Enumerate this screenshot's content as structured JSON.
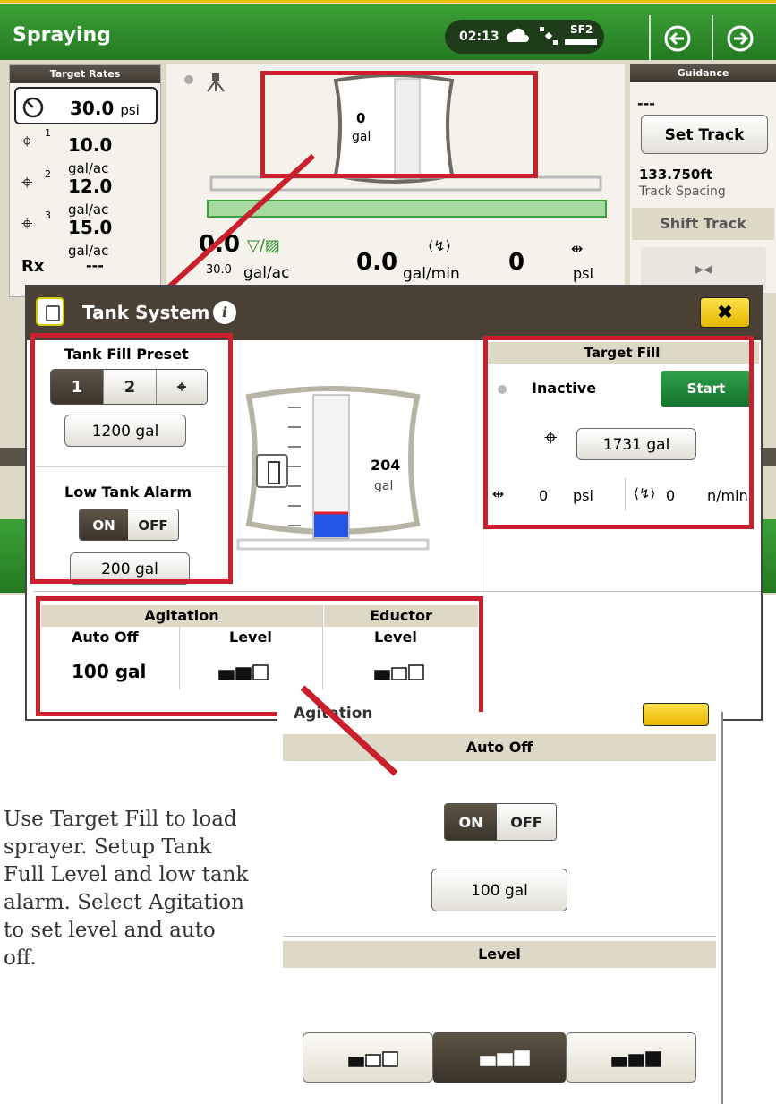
{
  "screen": {
    "title": "Spraying",
    "clock": "02:13",
    "signal_label": "SF2",
    "nav_back_icon": "circle-arrow-left-icon",
    "nav_forward_icon": "circle-arrow-right-icon"
  },
  "target_rates": {
    "header": "Target Rates",
    "rows": [
      {
        "icon": "pressure-gauge-icon",
        "value": "30.0",
        "unit": "psi"
      },
      {
        "icon": "target-1-icon",
        "sup": "1",
        "value": "10.0",
        "unit": "gal/ac"
      },
      {
        "icon": "target-2-icon",
        "sup": "2",
        "value": "12.0",
        "unit": "gal/ac"
      },
      {
        "icon": "target-3-icon",
        "sup": "3",
        "value": "15.0",
        "unit": "gal/ac"
      },
      {
        "label": "Rx",
        "value": "---"
      }
    ]
  },
  "center": {
    "tank_value": "0",
    "tank_unit": "gal",
    "rate_value": "0.0",
    "rate_sub": "30.0",
    "rate_unit": "gal/ac",
    "flow_value": "0.0",
    "flow_unit": "gal/min",
    "pressure_value": "0",
    "pressure_unit": "psi"
  },
  "guidance": {
    "header": "Guidance",
    "dashes": "---",
    "set_track": "Set Track",
    "spacing_value": "133.750ft",
    "spacing_label": "Track Spacing",
    "shift_track": "Shift Track"
  },
  "dialog": {
    "title": "Tank System",
    "tank_fill_preset": {
      "label": "Tank Fill Preset",
      "options": [
        "1",
        "2"
      ],
      "selected": "1",
      "value": "1200 gal"
    },
    "low_tank_alarm": {
      "label": "Low Tank Alarm",
      "on_label": "ON",
      "off_label": "OFF",
      "state": "ON",
      "value": "200 gal"
    },
    "tank_graphic": {
      "value": "204",
      "unit": "gal",
      "fill_fraction": 0.17
    },
    "target_fill": {
      "header": "Target Fill",
      "status": "Inactive",
      "start": "Start",
      "target_value": "1731 gal",
      "pressure_value": "0",
      "pressure_unit": "psi",
      "flow_value": "0",
      "flow_unit": "n/min"
    },
    "agitation": {
      "header": "Agitation",
      "col_auto_off": "Auto Off",
      "col_level": "Level",
      "auto_off_value": "100 gal",
      "level_filled": 2,
      "level_total": 3
    },
    "eductor": {
      "header": "Eductor",
      "col_level": "Level",
      "level_filled": 1,
      "level_total": 3
    }
  },
  "agitation_zoom": {
    "title_partial": "Agitation",
    "auto_off_header": "Auto Off",
    "on_label": "ON",
    "off_label": "OFF",
    "state": "ON",
    "value": "100 gal",
    "level_header": "Level",
    "selected_level": 2
  },
  "caption": "Use Target Fill to load sprayer. Setup Tank Full Level and low tank alarm. Select Agitation to set level and auto off."
}
